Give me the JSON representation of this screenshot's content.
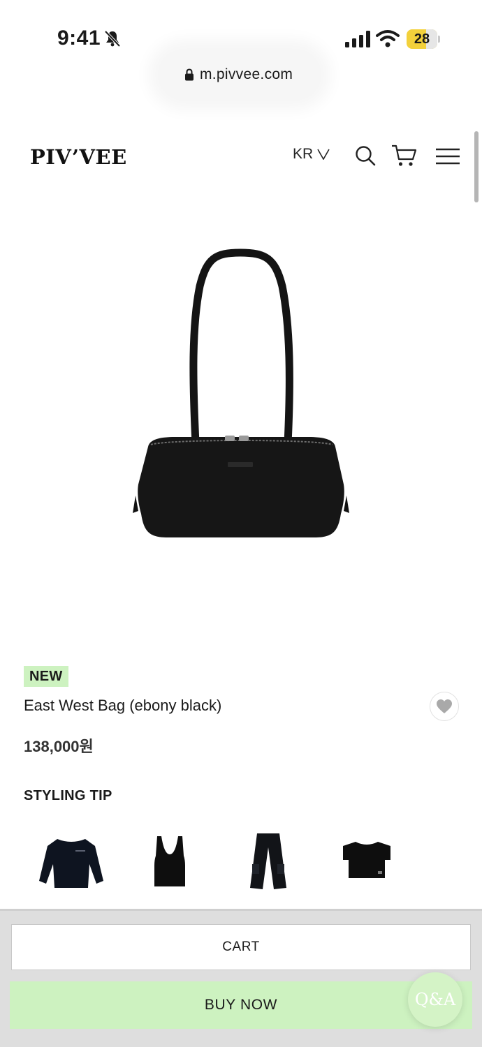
{
  "status_bar": {
    "time": "9:41",
    "battery_level": "28",
    "battery_fraction": 0.28,
    "battery_color": "#f3d13b"
  },
  "browser": {
    "url": "m.pivvee.com"
  },
  "header": {
    "logo": "PIV’VEE",
    "language": "KR",
    "icons": [
      "search-icon",
      "cart-icon",
      "hamburger-menu-icon"
    ]
  },
  "product": {
    "badge": "NEW",
    "badge_color": "#cdf2c0",
    "name": "East West Bag (ebony black)",
    "price": "138,000원",
    "image_icon": "black-shoulder-bag-image"
  },
  "styling_tip": {
    "title": "STYLING TIP",
    "items": [
      "black-sweatshirt-image",
      "black-tank-top-image",
      "black-cargo-pants-image",
      "black-tshirt-image"
    ]
  },
  "actions": {
    "cart_label": "CART",
    "buy_label": "BUY NOW",
    "qna_label": "Q&A",
    "accent_color": "#cdf2c0"
  }
}
